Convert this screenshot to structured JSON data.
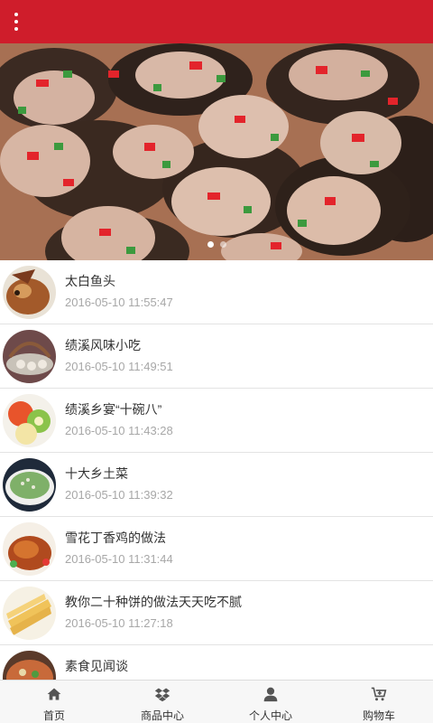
{
  "header": {
    "menu_icon": "more-vertical-icon",
    "color": "#cf1d2b"
  },
  "banner": {
    "image": "stuffed-mushroom-dish-photo",
    "slide_count": 2,
    "active_slide": 1
  },
  "articles": [
    {
      "title": "太白鱼头",
      "date": "2016-05-10 11:55:47",
      "thumb": "fish-head-photo"
    },
    {
      "title": "绩溪风味小吃",
      "date": "2016-05-10 11:49:51",
      "thumb": "dumpling-basket-photo"
    },
    {
      "title": "绩溪乡宴“十碗八”",
      "date": "2016-05-10 11:43:28",
      "thumb": "banquet-dishes-photo"
    },
    {
      "title": "十大乡土菜",
      "date": "2016-05-10 11:39:32",
      "thumb": "green-vegetable-dish-photo"
    },
    {
      "title": "雪花丁香鸡的做法",
      "date": "2016-05-10 11:31:44",
      "thumb": "roast-chicken-photo"
    },
    {
      "title": "教你二十种饼的做法天天吃不腻",
      "date": "2016-05-10 11:27:18",
      "thumb": "flatbread-photo"
    },
    {
      "title": "素食见闻谈",
      "date": "",
      "thumb": "vegetarian-dish-photo"
    }
  ],
  "nav": [
    {
      "label": "首页",
      "icon": "home-icon"
    },
    {
      "label": "商品中心",
      "icon": "dropbox-icon"
    },
    {
      "label": "个人中心",
      "icon": "user-icon"
    },
    {
      "label": "购物车",
      "icon": "cart-icon"
    }
  ]
}
